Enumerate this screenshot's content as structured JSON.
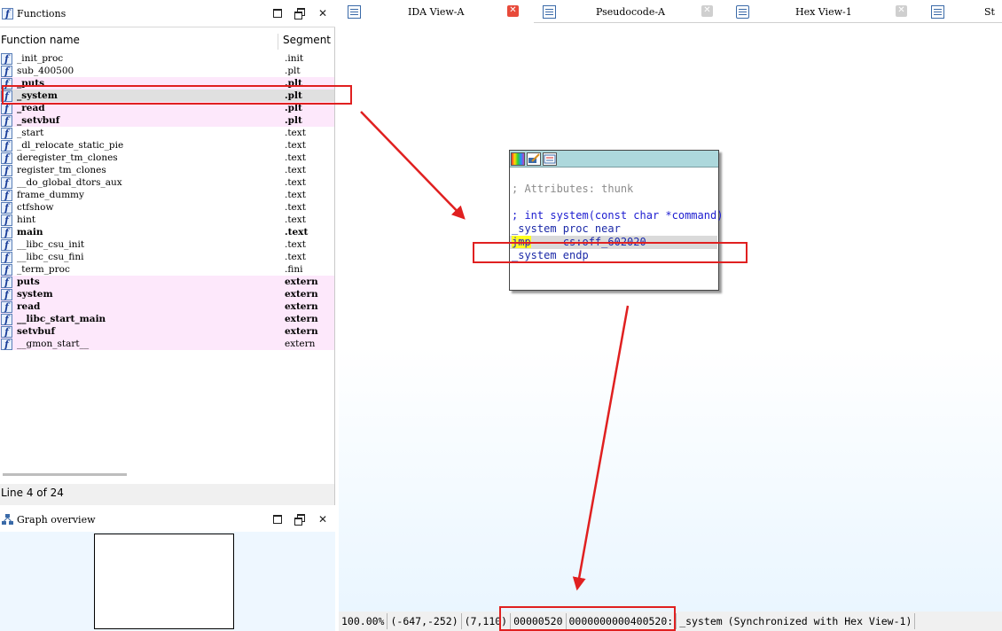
{
  "functions_window": {
    "title": "Functions",
    "columns": {
      "name": "Function name",
      "segment": "Segment"
    },
    "rows": [
      {
        "name": "_init_proc",
        "segment": ".init",
        "bold": false,
        "pink": false
      },
      {
        "name": "sub_400500",
        "segment": ".plt",
        "bold": false,
        "pink": false
      },
      {
        "name": "_puts",
        "segment": ".plt",
        "bold": true,
        "pink": true
      },
      {
        "name": "_system",
        "segment": ".plt",
        "bold": true,
        "pink": true,
        "selected": true
      },
      {
        "name": "_read",
        "segment": ".plt",
        "bold": true,
        "pink": true
      },
      {
        "name": "_setvbuf",
        "segment": ".plt",
        "bold": true,
        "pink": true
      },
      {
        "name": "_start",
        "segment": ".text",
        "bold": false,
        "pink": false
      },
      {
        "name": "_dl_relocate_static_pie",
        "segment": ".text",
        "bold": false,
        "pink": false
      },
      {
        "name": "deregister_tm_clones",
        "segment": ".text",
        "bold": false,
        "pink": false
      },
      {
        "name": "register_tm_clones",
        "segment": ".text",
        "bold": false,
        "pink": false
      },
      {
        "name": "__do_global_dtors_aux",
        "segment": ".text",
        "bold": false,
        "pink": false
      },
      {
        "name": "frame_dummy",
        "segment": ".text",
        "bold": false,
        "pink": false
      },
      {
        "name": "ctfshow",
        "segment": ".text",
        "bold": false,
        "pink": false
      },
      {
        "name": "hint",
        "segment": ".text",
        "bold": false,
        "pink": false
      },
      {
        "name": "main",
        "segment": ".text",
        "bold": true,
        "pink": false
      },
      {
        "name": "__libc_csu_init",
        "segment": ".text",
        "bold": false,
        "pink": false
      },
      {
        "name": "__libc_csu_fini",
        "segment": ".text",
        "bold": false,
        "pink": false
      },
      {
        "name": "_term_proc",
        "segment": ".fini",
        "bold": false,
        "pink": false
      },
      {
        "name": "puts",
        "segment": "extern",
        "bold": true,
        "pink": true
      },
      {
        "name": "system",
        "segment": "extern",
        "bold": true,
        "pink": true
      },
      {
        "name": "read",
        "segment": "extern",
        "bold": true,
        "pink": true
      },
      {
        "name": "__libc_start_main",
        "segment": "extern",
        "bold": true,
        "pink": true
      },
      {
        "name": "setvbuf",
        "segment": "extern",
        "bold": true,
        "pink": true
      },
      {
        "name": "__gmon_start__",
        "segment": "extern",
        "bold": false,
        "pink": true
      }
    ],
    "line_status": "Line 4 of 24"
  },
  "graph_overview": {
    "title": "Graph overview"
  },
  "tabs": [
    {
      "label": "IDA View-A",
      "close": "red"
    },
    {
      "label": "Pseudocode-A",
      "close": "grey"
    },
    {
      "label": "Hex View-1",
      "close": "grey"
    },
    {
      "label": "St",
      "close": "none"
    }
  ],
  "graph_node": {
    "lines": {
      "blank1": "",
      "attrs": "; Attributes: thunk",
      "blank2": "",
      "proto": "; int system(const char *command)",
      "proc": "_system proc near",
      "jmp_mnem": "jmp",
      "jmp_operand": "     cs:off_602020",
      "endp": "_system endp"
    }
  },
  "status_bar": {
    "zoom": "100.00%",
    "coords": "(-647,-252)",
    "pos": "(7,110)",
    "offset": "00000520",
    "address": "0000000000400520:",
    "func": "_system",
    "sync": "(Synchronized with Hex View-1)"
  },
  "colors": {
    "annotation_red": "#e02020",
    "pink_row": "#fde8fb",
    "node_header": "#add8dc",
    "jmp_highlight": "#ffff22"
  }
}
